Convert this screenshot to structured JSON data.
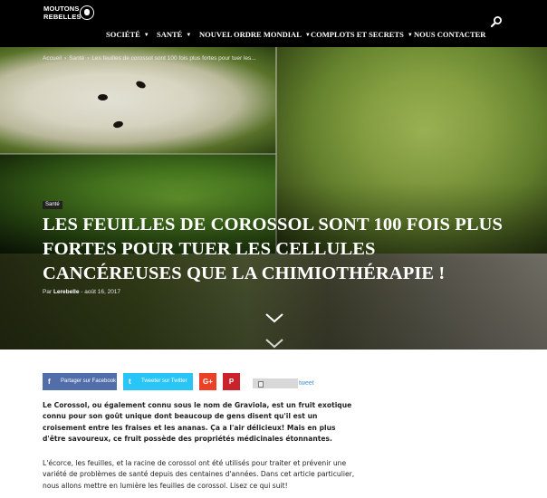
{
  "brand": {
    "line1": "MOUTONS",
    "line2": "REBELLES"
  },
  "nav": {
    "items": [
      {
        "label": "SOCIÉTÉ",
        "has_dropdown": true
      },
      {
        "label": "SANTÉ",
        "has_dropdown": true
      },
      {
        "label": "NOUVEL ORDRE MONDIAL",
        "has_dropdown": true
      },
      {
        "label": "COMPLOTS ET SECRETS",
        "has_dropdown": true
      },
      {
        "label": "NOUS CONTACTER",
        "has_dropdown": false
      }
    ],
    "search_icon": "search-icon"
  },
  "breadcrumb": {
    "home": "Accueil",
    "category": "Santé",
    "current": "Les feuilles de corossol sont 100 fois plus fortes pour tuer les..."
  },
  "article": {
    "category": "Santé",
    "title": "Les feuilles de corossol sont 100 fois plus fortes pour tuer les cellules cancéreuses que la chimiothérapie !",
    "by": "Par",
    "author": "Lerebelle",
    "date": "août 16, 2017"
  },
  "share": {
    "facebook": {
      "icon": "f",
      "label": "Partager sur Facebook"
    },
    "twitter": {
      "icon": "t",
      "label": "Tweeter sur Twitter"
    },
    "googleplus": {
      "icon": "G+"
    },
    "pinterest": {
      "icon": "P"
    },
    "tweet": "tweet"
  },
  "content": {
    "p1": "Le Corossol, ou également connu sous le nom de Graviola, est un fruit exotique connu pour son goût unique dont beaucoup de gens disent qu'il est un croisement entre les fraises et les ananas. Ça a l'air délicieux! Mais en plus d'être savoureux, ce fruit possède des propriétés médicinales étonnantes.",
    "p2": "L'écorce, les feuilles, et la racine de corossol ont été utilisés pour traiter et prévenir une variété de problèmes de santé depuis des centaines d'années. Dans cet article particulier, nous allons mettre en lumière les feuilles de corossol. Lisez ce qui suit!"
  },
  "colors": {
    "nav_bg": "#000000",
    "facebook": "#516eab",
    "twitter": "#29c5f6",
    "googleplus": "#eb4026",
    "pinterest": "#ca212a",
    "tweet_link": "#4a8fd4"
  }
}
